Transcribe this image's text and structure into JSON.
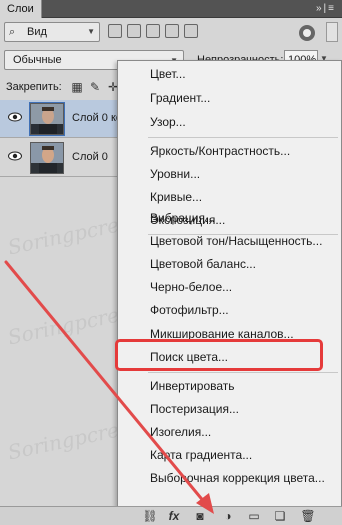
{
  "window": {
    "tab_label": "Слои",
    "controls": "»|≡"
  },
  "filter": {
    "value": "Вид"
  },
  "blend": {
    "mode": "Обычные",
    "opacity_label": "Непрозрачность:",
    "opacity_value": "100%"
  },
  "lock": {
    "label": "Закрепить:"
  },
  "layers": [
    {
      "name": "Слой 0 ко",
      "selected": true
    },
    {
      "name": "Слой 0",
      "selected": false
    }
  ],
  "menu": {
    "items": [
      "Цвет...",
      "Градиент...",
      "Узор...",
      "Яркость/Контрастность...",
      "Уровни...",
      "Кривые...",
      "Экспозиция...",
      "Вибрация...",
      "Цветовой тон/Насыщенность...",
      "Цветовой баланс...",
      "Черно-белое...",
      "Фотофильтр...",
      "Микширование каналов...",
      "Поиск цвета...",
      "Инвертировать",
      "Постеризация...",
      "Изогелия...",
      "Карта градиента...",
      "Выборочная коррекция цвета..."
    ],
    "highlighted_index": 12
  },
  "bottom_toolbar": {
    "fx_label": "fx"
  },
  "watermark": "Soringpcrepair.com",
  "colors": {
    "highlight_box": "#e53a3a",
    "arrow": "#e24b4b",
    "selected_layer": "#b9c9de"
  }
}
